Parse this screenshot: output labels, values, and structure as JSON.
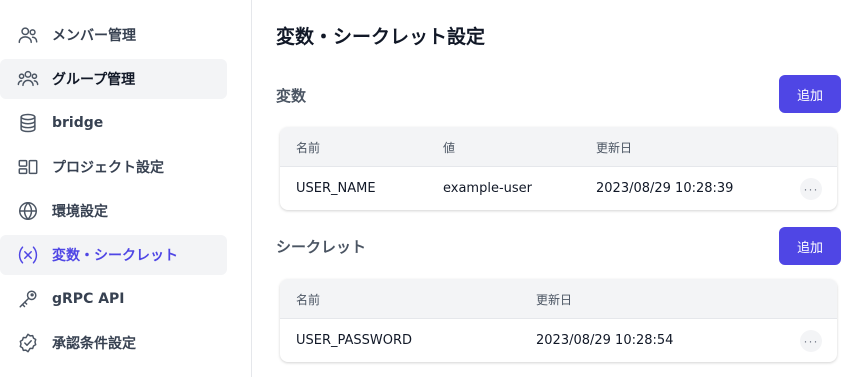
{
  "sidebar": {
    "items": [
      {
        "label": "メンバー管理",
        "icon": "users-icon"
      },
      {
        "label": "グループ管理",
        "icon": "group-icon"
      },
      {
        "label": "bridge",
        "icon": "database-icon"
      },
      {
        "label": "プロジェクト設定",
        "icon": "project-icon"
      },
      {
        "label": "環境設定",
        "icon": "globe-icon"
      },
      {
        "label": "変数・シークレット",
        "icon": "variable-icon"
      },
      {
        "label": "gRPC API",
        "icon": "key-icon"
      },
      {
        "label": "承認条件設定",
        "icon": "badge-check-icon"
      }
    ]
  },
  "main": {
    "title": "変数・シークレット設定",
    "variables": {
      "title": "変数",
      "add_label": "追加",
      "columns": [
        "名前",
        "値",
        "更新日"
      ],
      "rows": [
        {
          "name": "USER_NAME",
          "value": "example-user",
          "updated": "2023/08/29 10:28:39"
        }
      ]
    },
    "secrets": {
      "title": "シークレット",
      "add_label": "追加",
      "columns": [
        "名前",
        "更新日"
      ],
      "rows": [
        {
          "name": "USER_PASSWORD",
          "updated": "2023/08/29 10:28:54"
        }
      ]
    },
    "more_label": "···"
  },
  "colors": {
    "accent": "#4f46e5",
    "hover_bg": "#f3f4f6"
  }
}
